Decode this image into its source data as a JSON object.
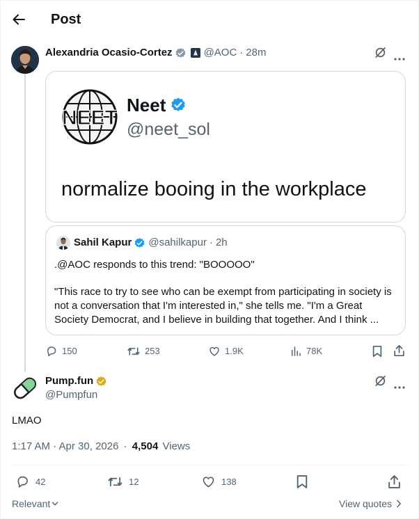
{
  "header": {
    "title": "Post"
  },
  "parent": {
    "author_name": "Alexandria Ocasio-Cortez",
    "handle": "@AOC",
    "time": "28m",
    "image": {
      "account_name": "Neet",
      "account_handle": "@neet_sol",
      "logo_text": "NEET",
      "text": "normalize booing in the workplace"
    },
    "quote": {
      "author_name": "Sahil Kapur",
      "handle": "@sahilkapur",
      "time": "2h",
      "line1": ".@AOC responds to this trend: \"BOOOOO\"",
      "line2": "\"This race to try to see who can be exempt from participating in society is not a conversation that I'm interested in,\" she tells me. \"I'm a Great Society Democrat, and I believe in building that together. And I think ..."
    },
    "actions": {
      "replies": "150",
      "reposts": "253",
      "likes": "1.9K",
      "views": "78K"
    }
  },
  "reply": {
    "author_name": "Pump.fun",
    "handle": "@Pumpfun",
    "text": "LMAO",
    "timestamp": "1:17 AM · Apr 30, 2026",
    "views_count": "4,504",
    "views_label": "Views",
    "actions": {
      "replies": "42",
      "reposts": "12",
      "likes": "138"
    },
    "relevant_label": "Relevant",
    "view_quotes_label": "View quotes"
  },
  "colors": {
    "verified_blue": "#1d9bf0",
    "verified_gold": "#e2a814",
    "muted": "#536471",
    "border": "#cfd9de"
  }
}
